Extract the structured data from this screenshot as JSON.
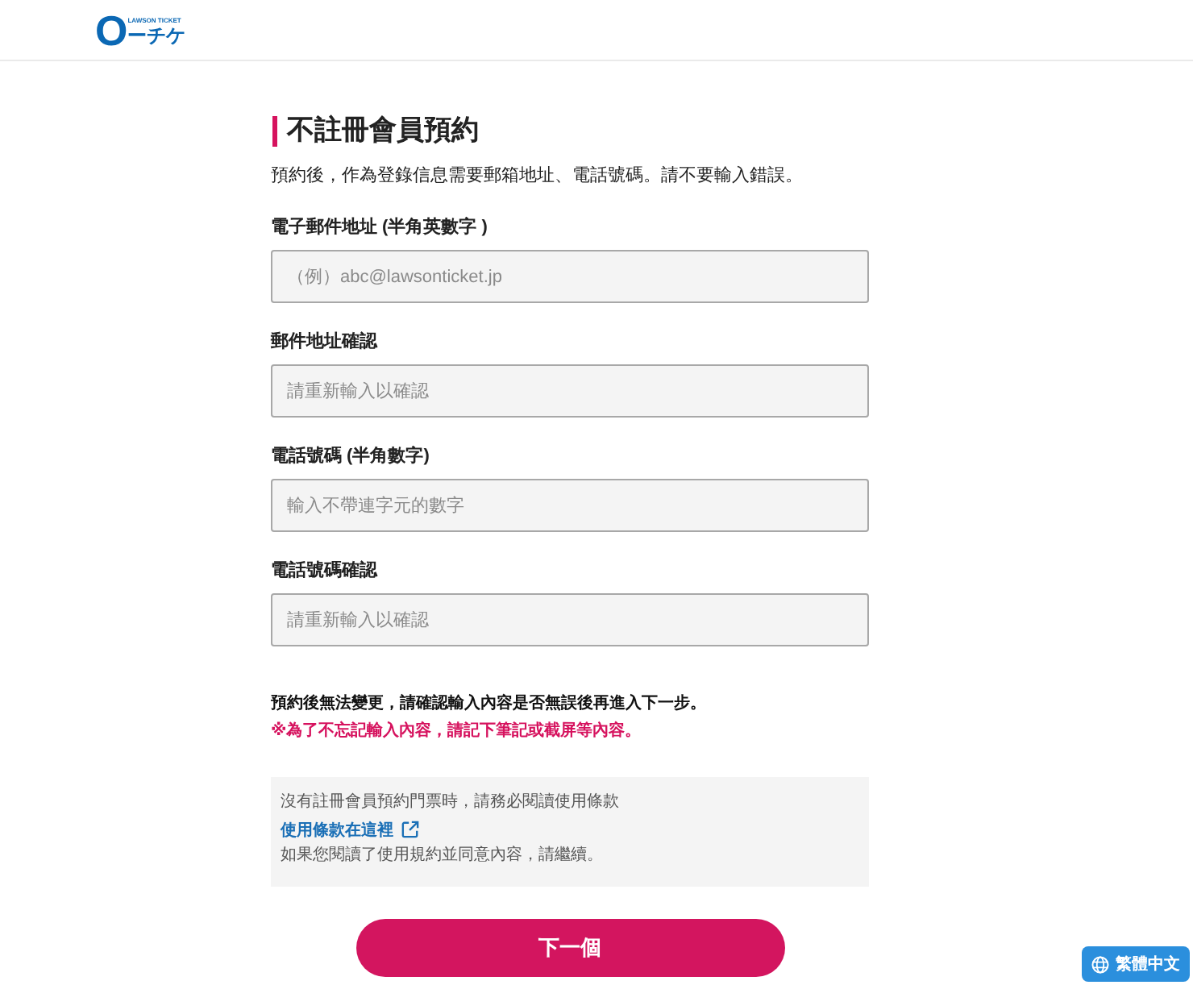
{
  "header": {
    "logo": {
      "mark": "O",
      "tagline": "LAWSON TICKET",
      "name": "ーチケ"
    }
  },
  "title": "不註冊會員預約",
  "intro": "預約後，作為登錄信息需要郵箱地址、電話號碼。請不要輸入錯誤。",
  "fields": [
    {
      "label": "電子郵件地址 (半角英數字 )",
      "placeholder": "（例）abc@lawsonticket.jp"
    },
    {
      "label": "郵件地址確認",
      "placeholder": "請重新輸入以確認"
    },
    {
      "label": "電話號碼 (半角數字)",
      "placeholder": "輸入不帶連字元的數字"
    },
    {
      "label": "電話號碼確認",
      "placeholder": "請重新輸入以確認"
    }
  ],
  "notes": [
    {
      "kind": "notice",
      "text": "預約後無法變更，請確認輸入內容是否無誤後再進入下一步。"
    },
    {
      "kind": "warning",
      "text": "※為了不忘記輸入內容，請記下筆記或截屏等內容。"
    }
  ],
  "terms": {
    "intro": "沒有註冊會員預約門票時，請務必閱讀使用條款",
    "link": "使用條款在這裡",
    "after": "如果您閱讀了使用規約並同意內容，請繼續。"
  },
  "next_button": "下一個",
  "language_button": "繁體中文"
}
